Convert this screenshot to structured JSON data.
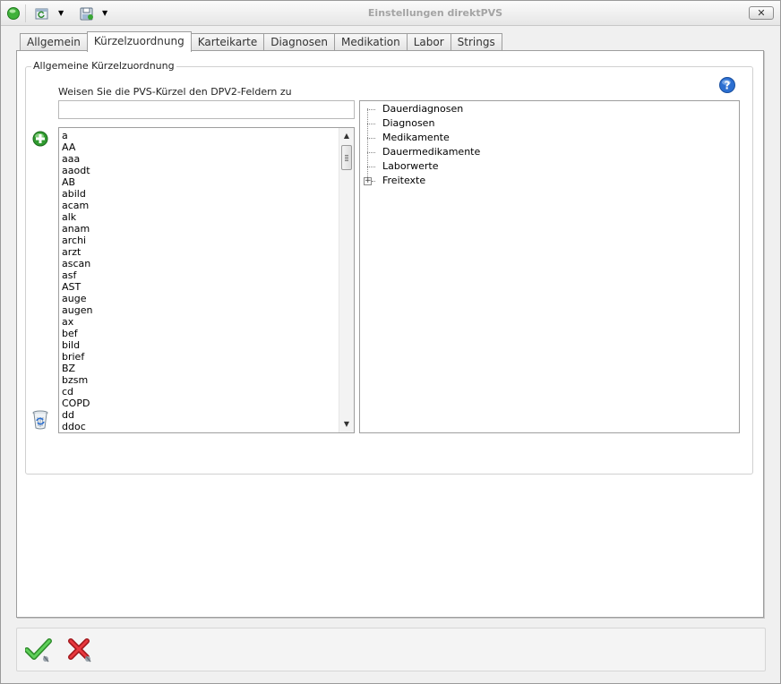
{
  "window": {
    "title": "Einstellungen direktPVS",
    "close_label": "✕"
  },
  "toolbar": {
    "icons": [
      "status-green-icon",
      "refresh-icon",
      "dropdown-arrow-icon",
      "save-icon",
      "dropdown-arrow-icon"
    ]
  },
  "tabs": [
    {
      "label": "Allgemein",
      "active": false
    },
    {
      "label": "Kürzelzuordnung",
      "active": true
    },
    {
      "label": "Karteikarte",
      "active": false
    },
    {
      "label": "Diagnosen",
      "active": false
    },
    {
      "label": "Medikation",
      "active": false
    },
    {
      "label": "Labor",
      "active": false
    },
    {
      "label": "Strings",
      "active": false
    }
  ],
  "group": {
    "legend": "Allgemeine Kürzelzuordnung",
    "instruction": "Weisen Sie die PVS-Kürzel den DPV2-Feldern zu",
    "filter_value": "",
    "shortcodes": [
      "a",
      "AA",
      "aaa",
      "aaodt",
      "AB",
      "abild",
      "acam",
      "alk",
      "anam",
      "archi",
      "arzt",
      "ascan",
      "asf",
      "AST",
      "auge",
      "augen",
      "ax",
      "bef",
      "bild",
      "brief",
      "BZ",
      "bzsm",
      "cd",
      "COPD",
      "dd",
      "ddoc"
    ],
    "tree": [
      {
        "label": "Dauerdiagnosen",
        "expandable": false
      },
      {
        "label": "Diagnosen",
        "expandable": false
      },
      {
        "label": "Medikamente",
        "expandable": false
      },
      {
        "label": "Dauermedikamente",
        "expandable": false
      },
      {
        "label": "Laborwerte",
        "expandable": false
      },
      {
        "label": "Freitexte",
        "expandable": true
      }
    ]
  },
  "colors": {
    "accent_blue": "#2c6fd1",
    "ok_green": "#3aa636",
    "cancel_red": "#d8262c",
    "add_green": "#2f9a2f"
  }
}
